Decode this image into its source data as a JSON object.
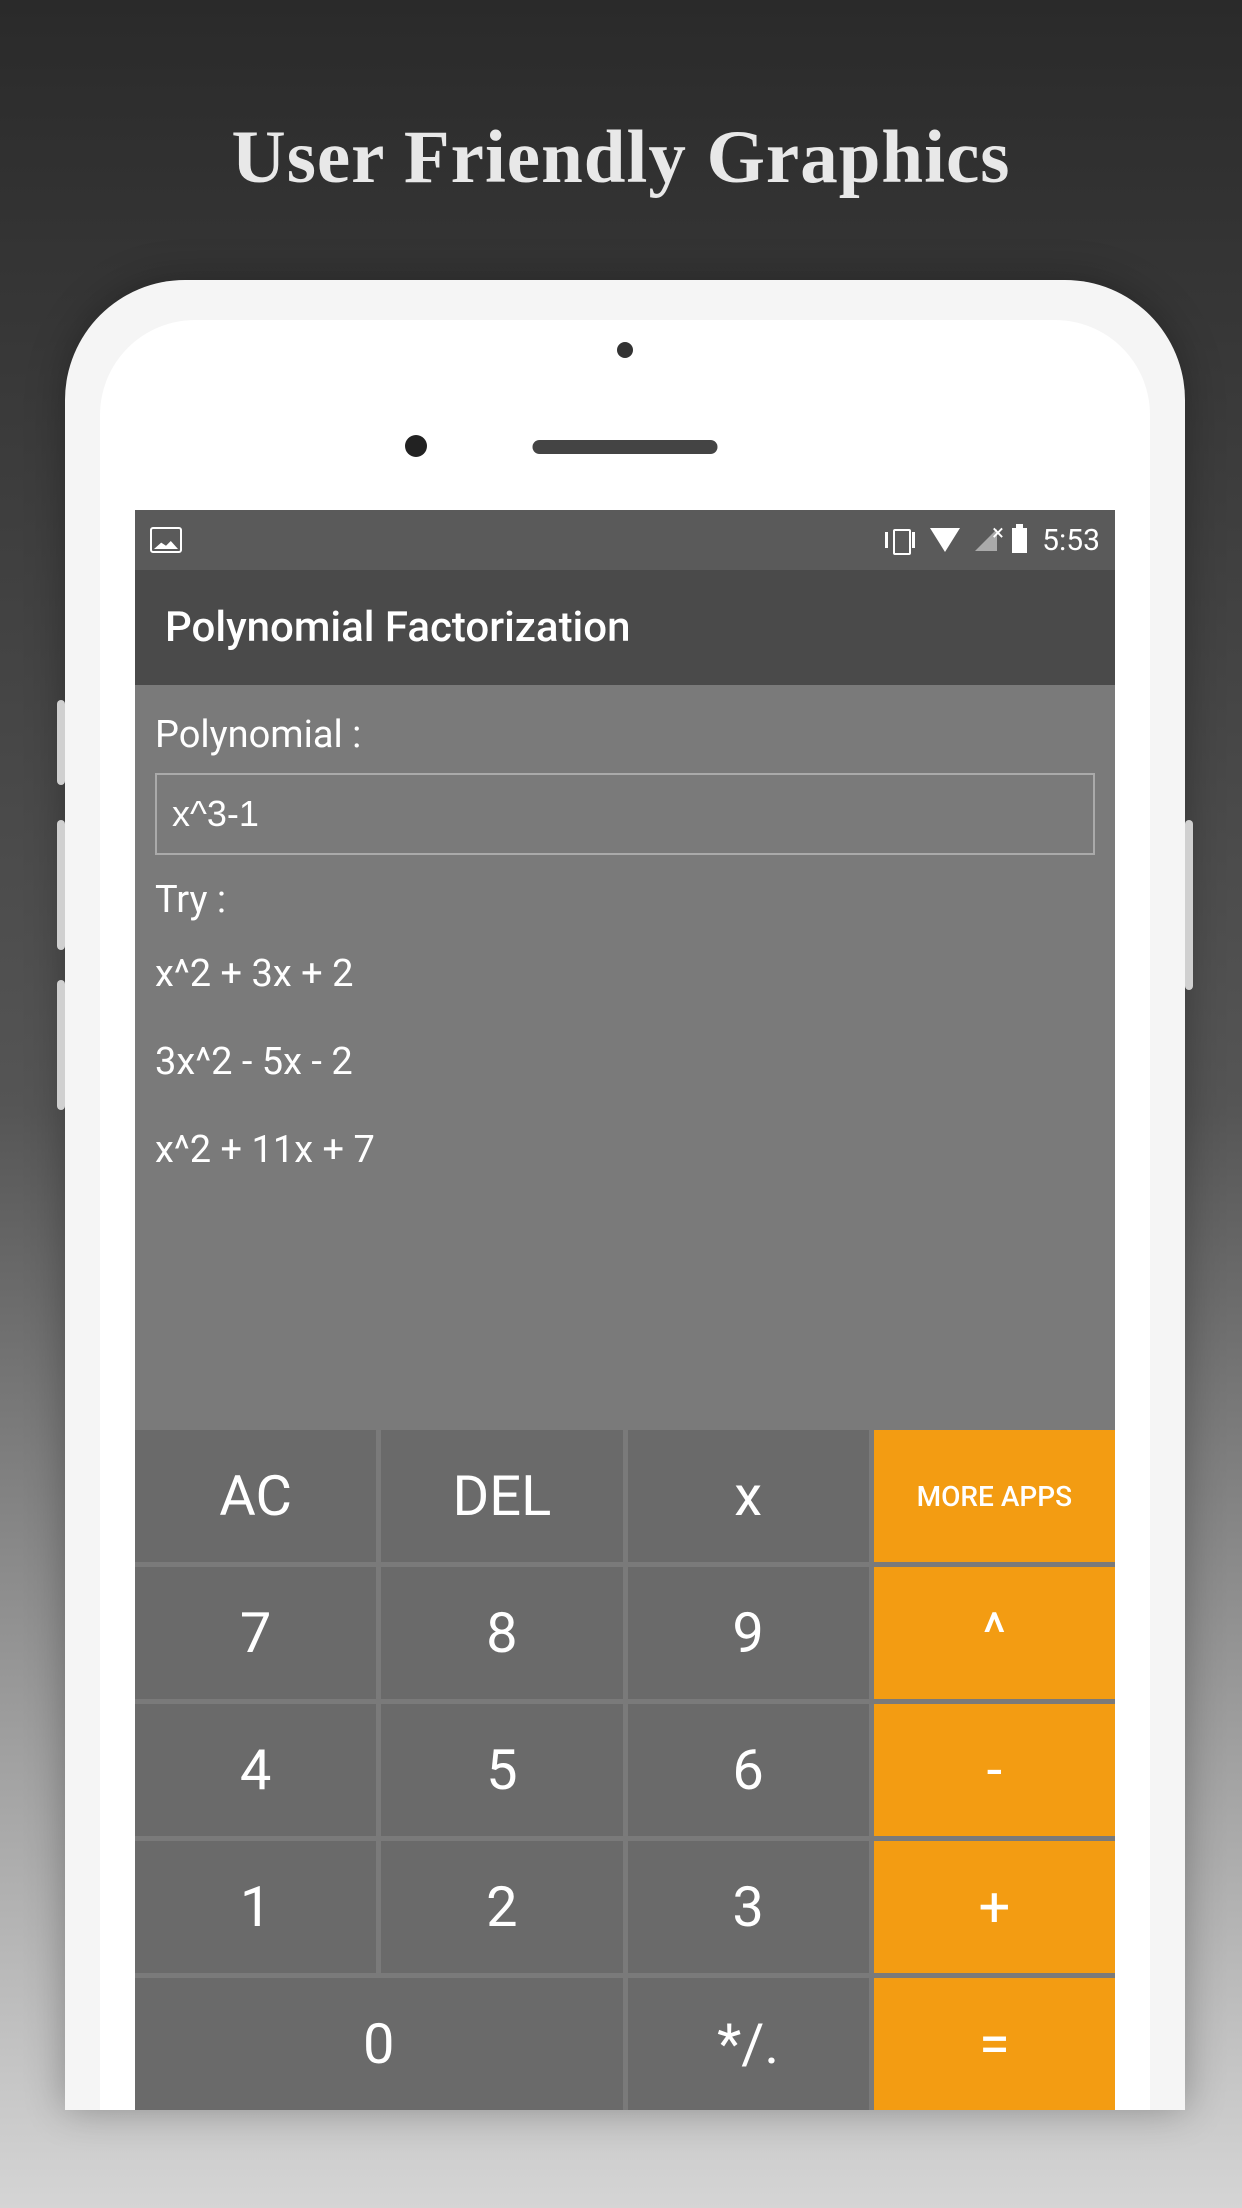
{
  "headline": "User Friendly Graphics",
  "statusBar": {
    "time": "5:53"
  },
  "appTitle": "Polynomial Factorization",
  "inputLabel": "Polynomial :",
  "inputValue": "x^3-1",
  "tryLabel": "Try :",
  "tryExamples": [
    "x^2 + 3x + 2",
    "3x^2 - 5x - 2",
    "x^2 + 11x + 7"
  ],
  "keypad": {
    "row1": [
      "AC",
      "DEL",
      "x",
      "MORE APPS"
    ],
    "row2": [
      "7",
      "8",
      "9",
      "^"
    ],
    "row3": [
      "4",
      "5",
      "6",
      "-"
    ],
    "row4": [
      "1",
      "2",
      "3",
      "+"
    ],
    "row5": [
      "0",
      "*/.",
      "="
    ]
  }
}
